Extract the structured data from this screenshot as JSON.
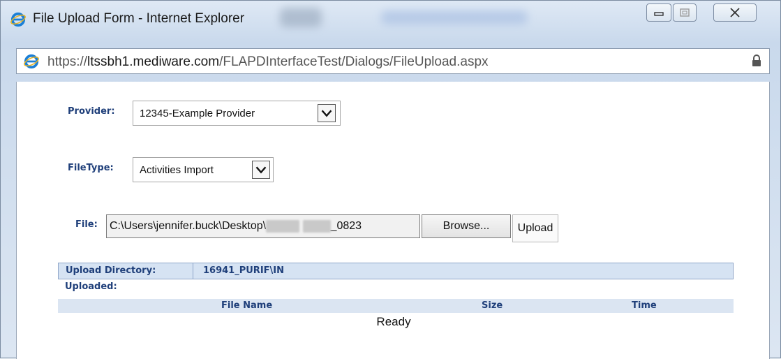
{
  "window": {
    "title": "File Upload Form - Internet Explorer",
    "controls": {
      "minimize": "minimize",
      "maximize": "maximize",
      "close": "close"
    }
  },
  "address": {
    "scheme": "https://",
    "host_pre": "ltssbh1.",
    "host_domain": "mediware.com",
    "path": "/FLAPDInterfaceTest/Dialogs/FileUpload.aspx"
  },
  "form": {
    "provider": {
      "label": "Provider:",
      "value": "12345-Example Provider"
    },
    "filetype": {
      "label": "FileType:",
      "value": "Activities Import"
    },
    "file": {
      "label": "File:",
      "value_prefix": "C:\\Users\\jennifer.buck\\Desktop\\",
      "value_suffix": "_0823",
      "browse_label": "Browse...",
      "upload_label": "Upload"
    }
  },
  "upload_directory": {
    "label": "Upload Directory:",
    "value": "16941_PURIF\\IN"
  },
  "uploaded": {
    "label": "Uploaded:",
    "columns": [
      "File Name",
      "Size",
      "Time"
    ],
    "rows": [],
    "status": "Ready"
  },
  "colors": {
    "label_blue": "#1f3f7a",
    "header_bg": "#d6e3f3",
    "ie_blue": "#1b7fd6"
  },
  "icons": {
    "browser": "ie-logo-icon",
    "lock": "lock-icon",
    "dropdown": "chevron-down-icon"
  }
}
